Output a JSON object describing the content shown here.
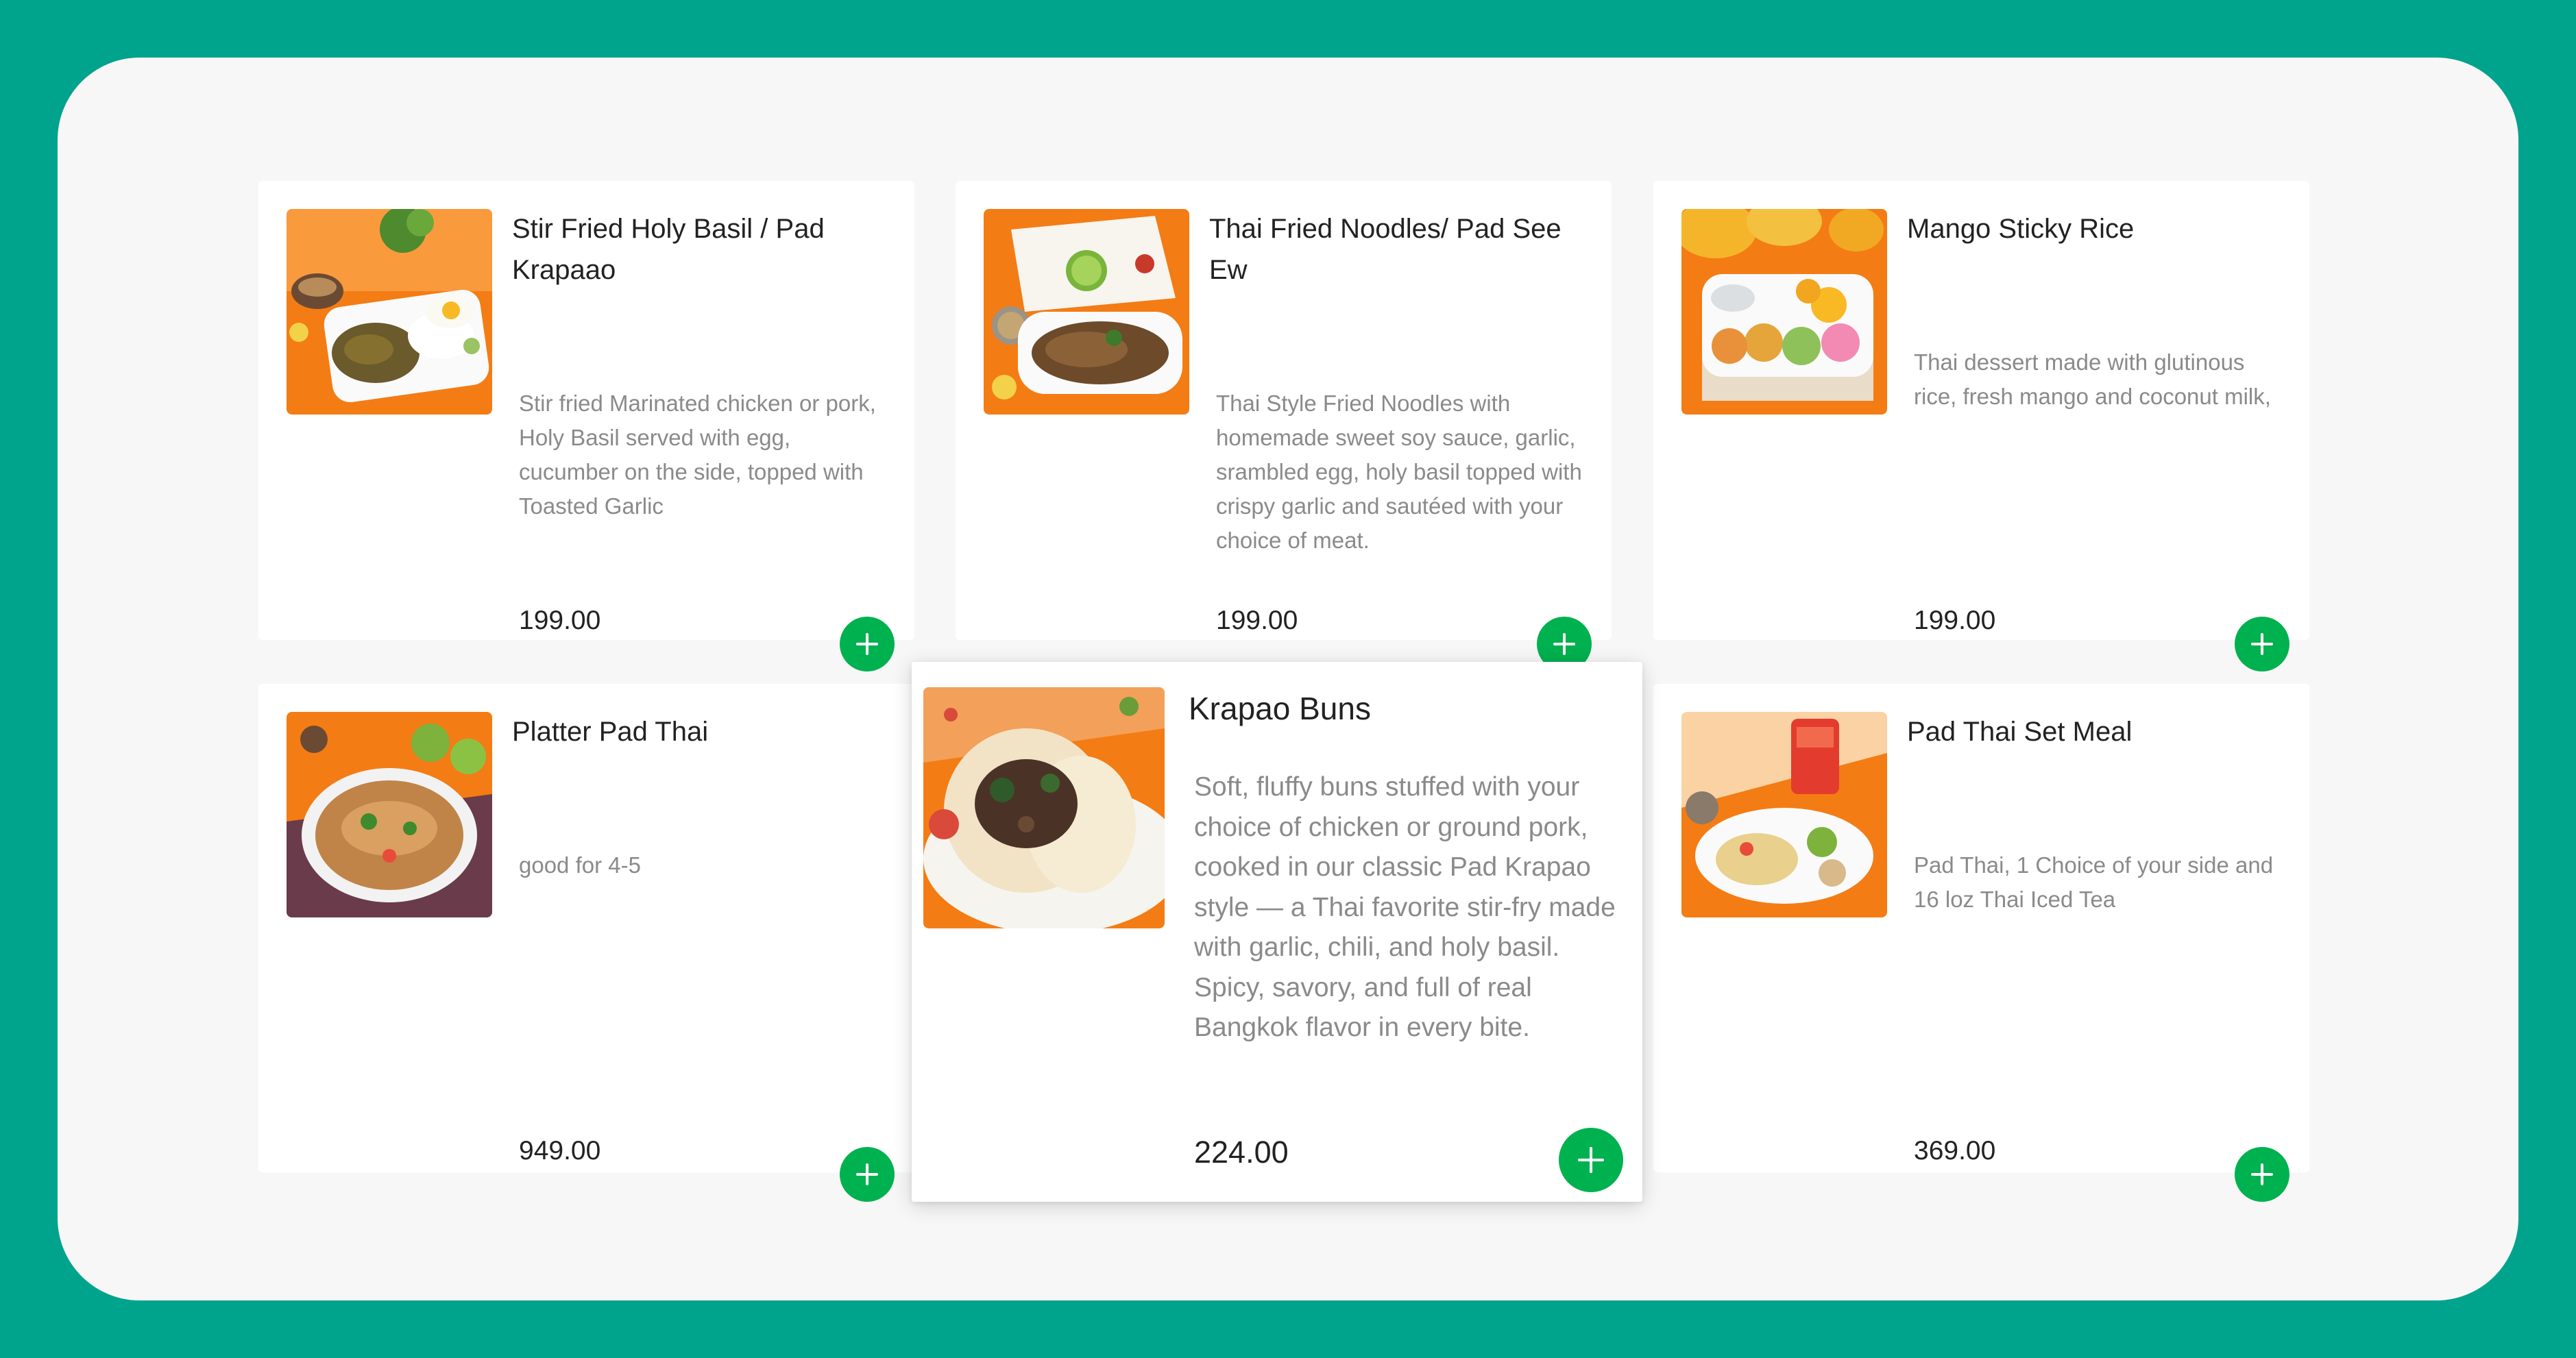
{
  "menu": {
    "items": [
      {
        "title": "Stir Fried Holy Basil / Pad Krapaao",
        "description": "Stir fried Marinated chicken or pork, Holy Basil served with egg, cucumber on the side, topped with Toasted Garlic",
        "price": "199.00",
        "image_icon": "pad-krapao-photo"
      },
      {
        "title": "Thai Fried Noodles/ Pad See Ew",
        "description": "Thai Style Fried Noodles with homemade sweet soy sauce, garlic, srambled egg, holy basil topped with crispy garlic and sautéed with your choice of meat.",
        "price": "199.00",
        "image_icon": "pad-see-ew-photo"
      },
      {
        "title": "Mango Sticky Rice",
        "description": "Thai dessert made with glutinous rice, fresh mango and coconut milk,",
        "price": "199.00",
        "image_icon": "mango-sticky-rice-photo"
      },
      {
        "title": "Platter Pad Thai",
        "description": "good for 4-5",
        "price": "949.00",
        "image_icon": "pad-thai-platter-photo"
      },
      {
        "title": "Krapao Buns",
        "description": "Soft, fluffy buns stuffed with your choice of chicken or ground pork, cooked in our classic Pad Krapao style — a Thai favorite stir-fry made with garlic, chili, and holy basil. Spicy, savory, and full of real Bangkok flavor in every bite.",
        "price": "224.00",
        "image_icon": "krapao-buns-photo"
      },
      {
        "title": "Pad Thai Set Meal",
        "description": "Pad Thai, 1 Choice of your side and 16 loz Thai Iced Tea",
        "price": "369.00",
        "image_icon": "pad-thai-set-meal-photo"
      }
    ],
    "add_icon": "plus-icon"
  },
  "colors": {
    "frame_background": "#00a38b",
    "panel_background": "#f7f7f7",
    "card_background": "#ffffff",
    "add_button": "#00b14f",
    "image_background": "#f47c14",
    "title_text": "#222222",
    "description_text": "#8a8a8a"
  }
}
